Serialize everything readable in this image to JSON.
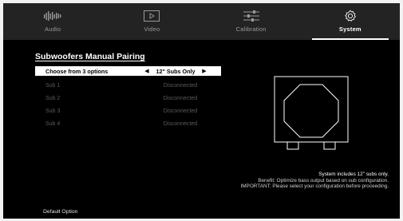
{
  "nav": {
    "tabs": [
      {
        "label": "Audio",
        "icon": "audio-equalizer-icon",
        "active": false
      },
      {
        "label": "Video",
        "icon": "video-play-icon",
        "active": false
      },
      {
        "label": "Calibration",
        "icon": "calibration-sliders-icon",
        "active": false
      },
      {
        "label": "System",
        "icon": "gear-icon",
        "active": true
      }
    ]
  },
  "page": {
    "title": "Subwoofers Manual Pairing"
  },
  "selector": {
    "label": "Choose from 3 options",
    "value": "12\" Subs Only",
    "left_arrow": "◀",
    "right_arrow": "▶"
  },
  "subs": [
    {
      "name": "Sub 1",
      "status": "Disconnected"
    },
    {
      "name": "Sub 2",
      "status": "Disconnected"
    },
    {
      "name": "Sub 3",
      "status": "Disconnected"
    },
    {
      "name": "Sub 4",
      "status": "Disconnected"
    }
  ],
  "info": {
    "line1": "System includes 12\" subs only.",
    "line2": "Benefit: Optimize bass output based on sub configuration.",
    "line3": "IMPORTANT: Please select your configuration before proceeding."
  },
  "footer": {
    "default_option": "Default Option"
  },
  "colors": {
    "background": "#000000",
    "nav_background": "#232323",
    "active_text": "#ffffff",
    "inactive_text": "#9a9a9a",
    "disabled_text": "#5a5a5a",
    "selection_bg": "#ffffff"
  }
}
